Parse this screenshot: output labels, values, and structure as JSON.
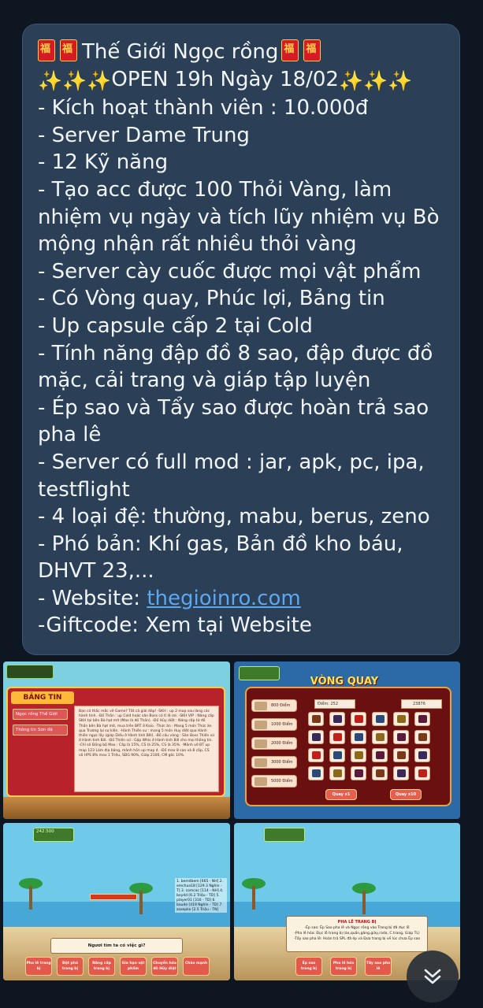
{
  "message": {
    "title": "Thế Giới Ngọc rồng",
    "open_line": "OPEN 19h Ngày 18/02",
    "lines": [
      "- Kích hoạt thành viên : 10.000đ",
      "- Server Dame Trung",
      "- 12 Kỹ năng",
      "- Tạo acc được 100 Thỏi Vàng, làm nhiệm vụ ngày và tích lũy nhiệm vụ Bò mộng nhận rất nhiều thỏi vàng",
      "- Server cày cuốc được mọi vật phẩm",
      "- Có Vòng quay, Phúc lợi, Bảng tin",
      "- Up capsule cấp 2 tại Cold",
      "- Tính năng đập đồ 8 sao, đập được đồ mặc, cải trang và giáp tập luyện",
      "- Ép sao và Tẩy sao được hoàn trả sao pha lê",
      "- Server có full mod : jar, apk, pc, ipa, testflight",
      "- 4 loại đệ: thường, mabu, berus, zeno",
      "- Phó bản: Khí gas, Bản đồ kho báu, DHVT 23,..."
    ],
    "website_prefix": "- Website: ",
    "website_link": "thegioinro.com",
    "giftcode": "-Giftcode: Xem tại Website"
  },
  "shot1": {
    "title": "BẢNG TIN",
    "tabs": [
      "Ngọc rồng Thế Giới",
      "Thông tin Sơn đệ"
    ],
    "content": "Bạn có thắc mắc về Game? Tất cả giải đáp! -SKH : up 2 map sau làng các hành tinh. -Đồ Thần : up Cold hoặc săn Boss có tỉ lệ rơi. -SKH VIP : Nâng cấp SKH tại bên Bà hạt mít (Max là đồ Thần). -Đồ Hủy diệt : Nâng cấp từ đồ Thần bên Bà hạt mít, mua trên BRT ở Kaio. -Thức ăn : Mang 5 món Thức ăn qua Trương lại sự kiện. -Hành Thiên sư : mang 5 món Huy diệt qua Hành thiên ngực lấy (giáp Diếu ở Hành tinh BIll). -Bồ cầu vàng : Săn Boss Thiên sứ ở Hành tinh Bill. -Đồ Thiên sứ : Gặp Whis ở Hành tinh Bill cho mọi thông tin. -Chỉ số Đồng bộ Max : Cấp là 15%, CS là 25%, CS là 35%. -Mảnh vỡ BT up map 123 Làm địa bảng, mảnh hồn up map 4. -Đồ max 8 sao và 8 cấp, CS vô HPS 8% max 1 Triệu, SĐG 90%, Giáp 2100, CM gốc 10%."
  },
  "shot2": {
    "title": "VÒNG QUAY",
    "points": [
      "800 Điểm",
      "1000 Điểm",
      "2000 Điểm",
      "3000 Điểm",
      "5000 Điểm"
    ],
    "diem_label": "Điểm: 252",
    "ticket_value": "23876",
    "btn1": "Quay x1",
    "btn2": "Quay x10"
  },
  "shot3": {
    "hud": "242.500",
    "leaderboard": "1. bem4bem [665 - NH] 2. emchua18 [129.3 Nghìn - T] 3. comcac [114 - NH] 4. boy4d [6.2 Triệu - TD] 5. player01 [316 - TD] 6. baude [419 Nghìn - TD] 7. zoxepko [2.5 Triệu - TN]",
    "dialog": "Ngươi tìm ta có việc gì?",
    "buttons": [
      "Pha lê trang bị",
      "Đột phá trang bị",
      "Nâng cấp trang bị",
      "Gia hạn vật phẩm",
      "Chuyển hóa đồ Hủy diệt",
      "Chào mạnh"
    ]
  },
  "shot4": {
    "dialog_title": "PHA LÊ TRANG BỊ",
    "dialog_lines": [
      "-Ép sao: Ép Sao pha lê và Ngọc rồng vào Trang bị đã đục lỗ",
      "-Pha lê hóa: Đục lỗ trang bị (áo,quần,găng,giày,rada, C.trang, Giáp TL)",
      "-Tẩy sao pha lê: Hoàn trả SPL đã ép và Đưa trang bị về lúc chưa Ép sao"
    ],
    "buttons": [
      "Ép sao trang bị",
      "Pha lê hóa trang bị",
      "Tẩy sao pha lê"
    ]
  },
  "icons": {
    "red_envelope": "red-envelope-icon",
    "sparkles": "sparkles-icon",
    "scroll_down": "chevron-double-down-icon"
  },
  "colors": {
    "background": "#0e1621",
    "bubble": "#2b3f57",
    "link": "#5ba8f0"
  }
}
